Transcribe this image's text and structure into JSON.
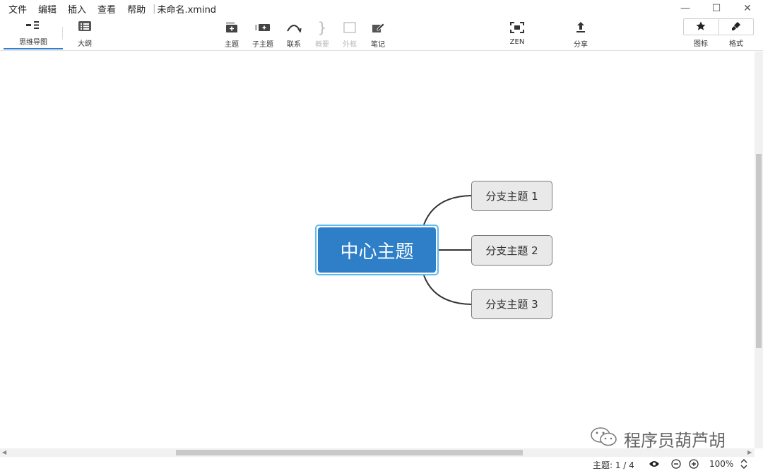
{
  "menu": {
    "items": [
      "文件",
      "编辑",
      "插入",
      "查看",
      "帮助"
    ],
    "doc_title": "未命名.xmind"
  },
  "window": {
    "minimize": "—",
    "maximize": "☐",
    "close": "✕"
  },
  "view_tabs": {
    "mindmap": "思维导图",
    "outline": "大纲"
  },
  "toolbar": {
    "topic": "主题",
    "subtopic": "子主题",
    "relationship": "联系",
    "summary": "概要",
    "boundary": "外框",
    "note": "笔记",
    "zen": "ZEN",
    "share": "分享",
    "icons": "图标",
    "format": "格式"
  },
  "mindmap": {
    "central": "中心主题",
    "branches": [
      "分支主题 1",
      "分支主题 2",
      "分支主题 3"
    ]
  },
  "watermark": "程序员葫芦胡",
  "status": {
    "topic_count": "主题: 1 / 4",
    "zoom": "100%"
  },
  "colors": {
    "central_fill": "#2f7fc8",
    "selection": "#5cbcf0",
    "active_tab": "#2f7fd1"
  }
}
